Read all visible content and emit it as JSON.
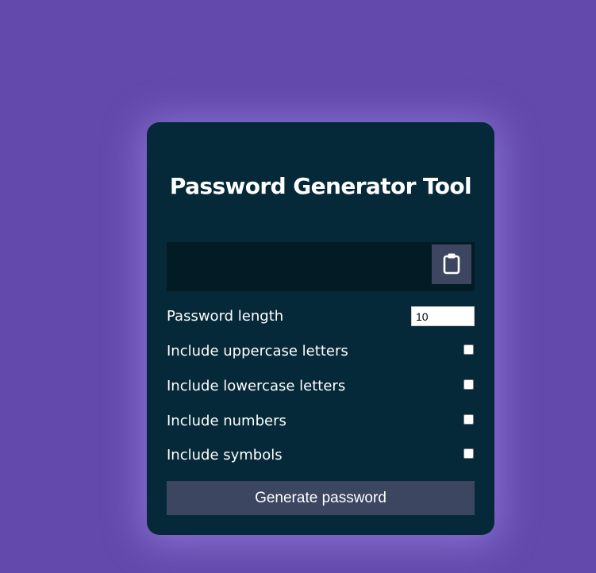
{
  "app": {
    "title": "Password Generator Tool"
  },
  "result": {
    "password": "",
    "copy_icon": "clipboard-icon"
  },
  "settings": {
    "length_label": "Password length",
    "length_value": "10",
    "uppercase_label": "Include uppercase letters",
    "uppercase_checked": false,
    "lowercase_label": "Include lowercase letters",
    "lowercase_checked": false,
    "numbers_label": "Include numbers",
    "numbers_checked": false,
    "symbols_label": "Include symbols",
    "symbols_checked": false
  },
  "actions": {
    "generate_label": "Generate password"
  },
  "colors": {
    "background": "#6249ab",
    "card": "#062939",
    "result_bg": "#031b24",
    "button": "#3d4660",
    "text": "#ffffff"
  }
}
